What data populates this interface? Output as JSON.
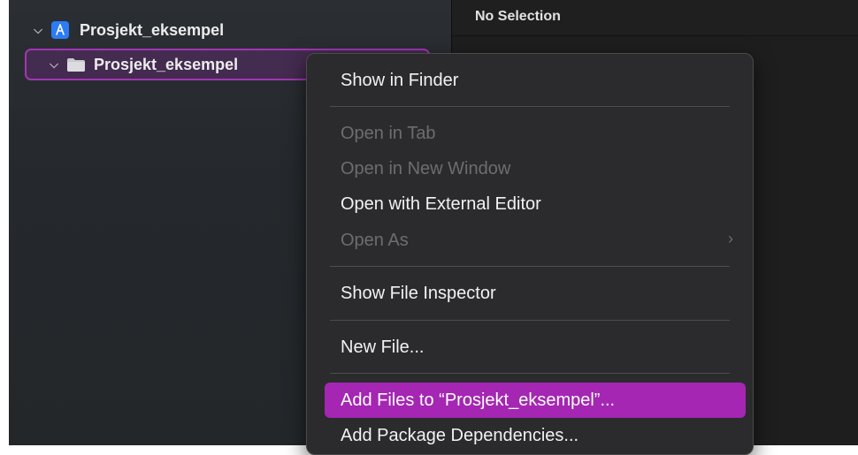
{
  "navigator": {
    "project_label": "Prosjekt_eksempel",
    "folder_label": "Prosjekt_eksempel"
  },
  "editor": {
    "no_selection": "No Selection"
  },
  "context_menu": {
    "items": [
      {
        "label": "Show in Finder",
        "enabled": true
      },
      {
        "label": "Open in Tab",
        "enabled": false
      },
      {
        "label": "Open in New Window",
        "enabled": false
      },
      {
        "label": "Open with External Editor",
        "enabled": true
      },
      {
        "label": "Open As",
        "enabled": false,
        "submenu": true
      },
      {
        "label": "Show File Inspector",
        "enabled": true
      },
      {
        "label": "New File...",
        "enabled": true
      },
      {
        "label": "Add Files to “Prosjekt_eksempel”...",
        "enabled": true,
        "highlighted": true
      },
      {
        "label": "Add Package Dependencies...",
        "enabled": true
      }
    ]
  },
  "colors": {
    "accent": "#a426b3",
    "app_icon": "#2c7cf6"
  }
}
